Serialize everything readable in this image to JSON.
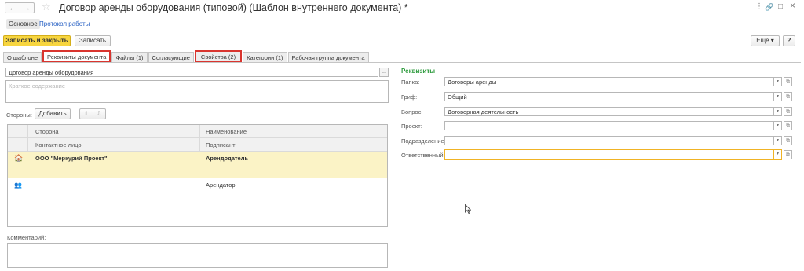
{
  "header": {
    "nav_back": "←",
    "nav_forward": "→",
    "favorite_icon": "☆",
    "title": "Договор аренды оборудования (типовой) (Шаблон внутреннего документа) *",
    "more_icon": "⋮",
    "link_icon": "🔗",
    "maximize_icon": "□",
    "close_icon": "×"
  },
  "sections": {
    "main": "Основное",
    "protocol": "Протокол работы"
  },
  "toolbar": {
    "save_close": "Записать и закрыть",
    "save": "Записать",
    "more": "Еще ▾",
    "help": "?"
  },
  "tabs": [
    {
      "label": "О шаблоне"
    },
    {
      "label": "Реквизиты документа"
    },
    {
      "label": "Файлы (1)"
    },
    {
      "label": "Согласующие"
    },
    {
      "label": "Свойства (2)"
    },
    {
      "label": "Категории (1)"
    },
    {
      "label": "Рабочая группа документа"
    }
  ],
  "form": {
    "name_value": "Договор аренды оборудования",
    "summary_placeholder": "Краткое содержание",
    "ellipsis": "...",
    "sides_label": "Стороны:",
    "add_button": "Добавить",
    "up_arrow": "⇧",
    "down_arrow": "⇩",
    "comment_label": "Комментарий:"
  },
  "parties_table": {
    "headers": {
      "side": "Сторона",
      "contact": "Контактное лицо",
      "name": "Наименование",
      "signer": "Подписант"
    },
    "rows": [
      {
        "icon": "🏠",
        "side": "ООО \"Меркурий Проект\"",
        "role": "Арендодатель"
      },
      {
        "icon": "👥",
        "side": "",
        "role": "Арендатор"
      }
    ]
  },
  "requisites": {
    "title": "Реквизиты",
    "fields": [
      {
        "label": "Папка:",
        "value": "Договоры аренды"
      },
      {
        "label": "Гриф:",
        "value": "Общий"
      },
      {
        "label": "Вопрос:",
        "value": "Договорная деятельность"
      },
      {
        "label": "Проект:",
        "value": ""
      },
      {
        "label": "Подразделение:",
        "value": ""
      },
      {
        "label": "Ответственный:",
        "value": ""
      }
    ],
    "dropdown_icon": "▾",
    "open_icon": "⧉"
  },
  "colors": {
    "primary_button": "#f7d53f",
    "selected_row": "#fbf3c6",
    "section_title": "#2c9a3c",
    "highlight_box": "#d9352f",
    "link": "#2a62c4"
  }
}
